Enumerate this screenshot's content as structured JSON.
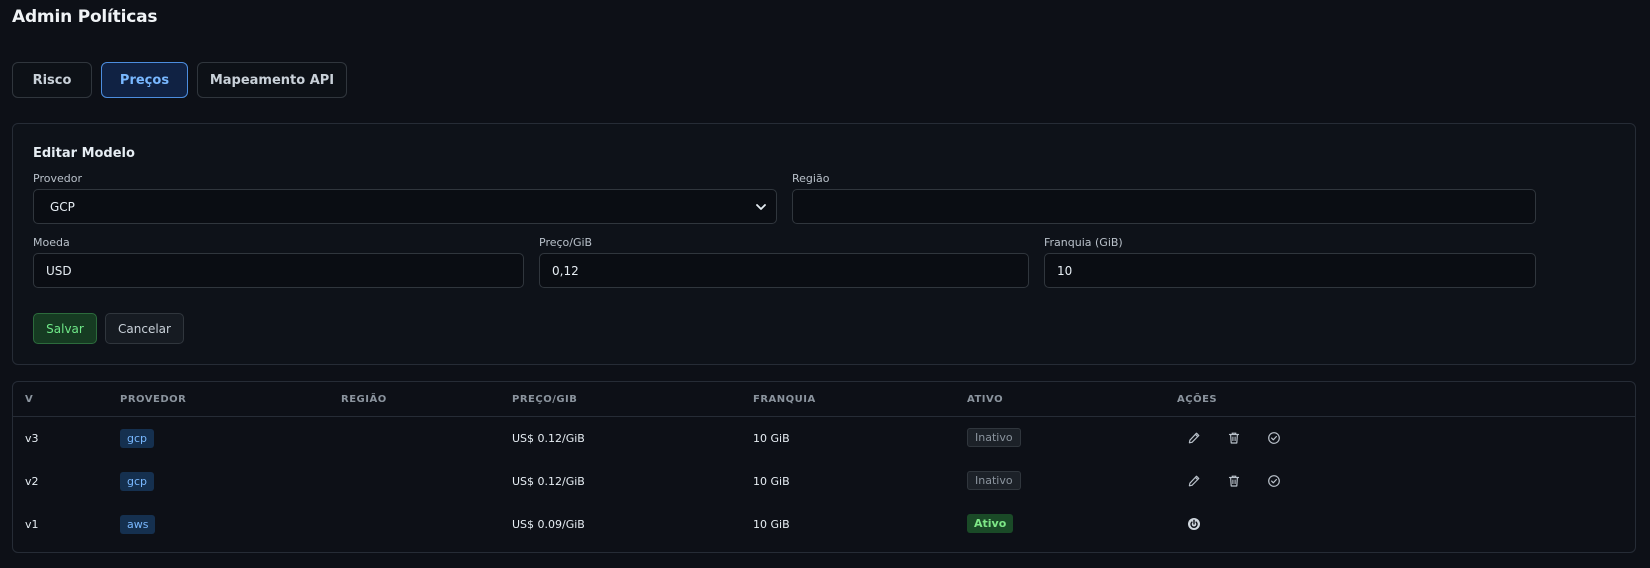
{
  "page": {
    "title": "Admin Políticas"
  },
  "tabs": [
    {
      "label": "Risco",
      "active": false
    },
    {
      "label": "Preços",
      "active": true
    },
    {
      "label": "Mapeamento API",
      "active": false
    }
  ],
  "form": {
    "title": "Editar Modelo",
    "provedor": {
      "label": "Provedor",
      "value": "GCP"
    },
    "regiao": {
      "label": "Região",
      "value": ""
    },
    "moeda": {
      "label": "Moeda",
      "value": "USD"
    },
    "preco": {
      "label": "Preço/GiB",
      "value": "0,12"
    },
    "franquia": {
      "label": "Franquia (GiB)",
      "value": "10"
    },
    "save_label": "Salvar",
    "cancel_label": "Cancelar"
  },
  "table": {
    "headers": {
      "v": "V",
      "provedor": "PROVEDOR",
      "regiao": "REGIÃO",
      "preco": "PREÇO/GIB",
      "franquia": "FRANQUIA",
      "ativo": "ATIVO",
      "acoes": "AÇÕES"
    },
    "rows": [
      {
        "v": "v3",
        "provedor": "gcp",
        "regiao": "",
        "preco": "US$ 0.12/GiB",
        "franquia": "10 GiB",
        "status": "Inativo"
      },
      {
        "v": "v2",
        "provedor": "gcp",
        "regiao": "",
        "preco": "US$ 0.12/GiB",
        "franquia": "10 GiB",
        "status": "Inativo"
      },
      {
        "v": "v1",
        "provedor": "aws",
        "regiao": "",
        "preco": "US$ 0.09/GiB",
        "franquia": "10 GiB",
        "status": "Ativo"
      }
    ]
  },
  "icons": {
    "edit": "pencil-icon",
    "delete": "trash-icon",
    "activate": "check-circle-icon",
    "deactivate": "power-icon",
    "select": "chevron-down-icon"
  },
  "colors": {
    "background": "#0d1017",
    "accent": "#79b8ff",
    "success": "#7ee787",
    "muted": "#8b949e"
  }
}
